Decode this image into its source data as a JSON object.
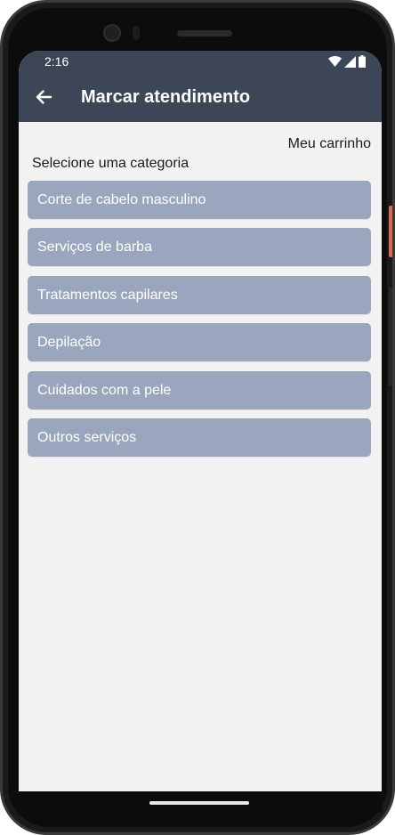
{
  "status_bar": {
    "time": "2:16",
    "icons": [
      "wifi-icon",
      "signal-icon",
      "battery-icon"
    ]
  },
  "app_bar": {
    "back_icon": "arrow-left-icon",
    "title": "Marcar atendimento",
    "color": "#3c4656"
  },
  "cart": {
    "label": "Meu carrinho"
  },
  "categories": {
    "heading": "Selecione uma categoria",
    "button_color": "#9aa6bd",
    "items": [
      {
        "label": "Corte de cabelo masculino"
      },
      {
        "label": "Serviços de barba"
      },
      {
        "label": "Tratamentos capilares"
      },
      {
        "label": "Depilação"
      },
      {
        "label": "Cuidados com a pele"
      },
      {
        "label": "Outros serviços"
      }
    ]
  }
}
